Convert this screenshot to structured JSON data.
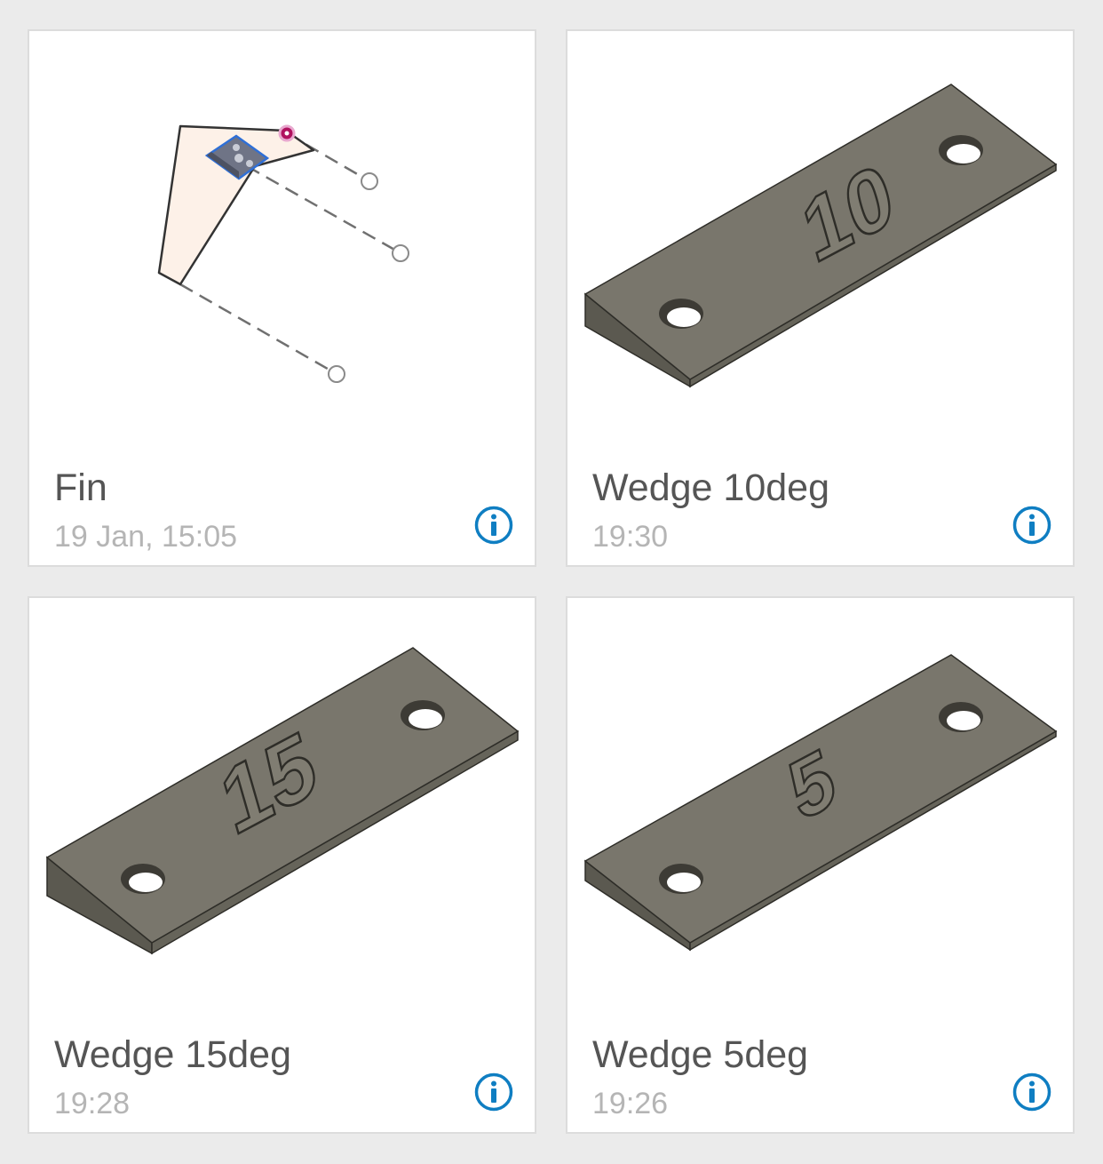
{
  "colors": {
    "background": "#ebebeb",
    "card": "#ffffff",
    "title": "#555555",
    "date": "#b5b5b5",
    "info_accent": "#0f7ec2",
    "part_top": "#79766c",
    "part_side": "#5b5950",
    "fin_fill": "#fdf1e8",
    "fin_handle": "#b0125f"
  },
  "documents": [
    {
      "title": "Fin",
      "date": "19 Jan, 15:05",
      "thumbnail_icon": "fin-sketch-thumbnail",
      "info_icon": "info-icon"
    },
    {
      "title": "Wedge 10deg",
      "date": "19:30",
      "thumbnail_icon": "wedge-part-thumbnail",
      "engraving": "10",
      "info_icon": "info-icon"
    },
    {
      "title": "Wedge 15deg",
      "date": "19:28",
      "thumbnail_icon": "wedge-part-thumbnail",
      "engraving": "15",
      "info_icon": "info-icon"
    },
    {
      "title": "Wedge 5deg",
      "date": "19:26",
      "thumbnail_icon": "wedge-part-thumbnail",
      "engraving": "5",
      "info_icon": "info-icon"
    }
  ]
}
